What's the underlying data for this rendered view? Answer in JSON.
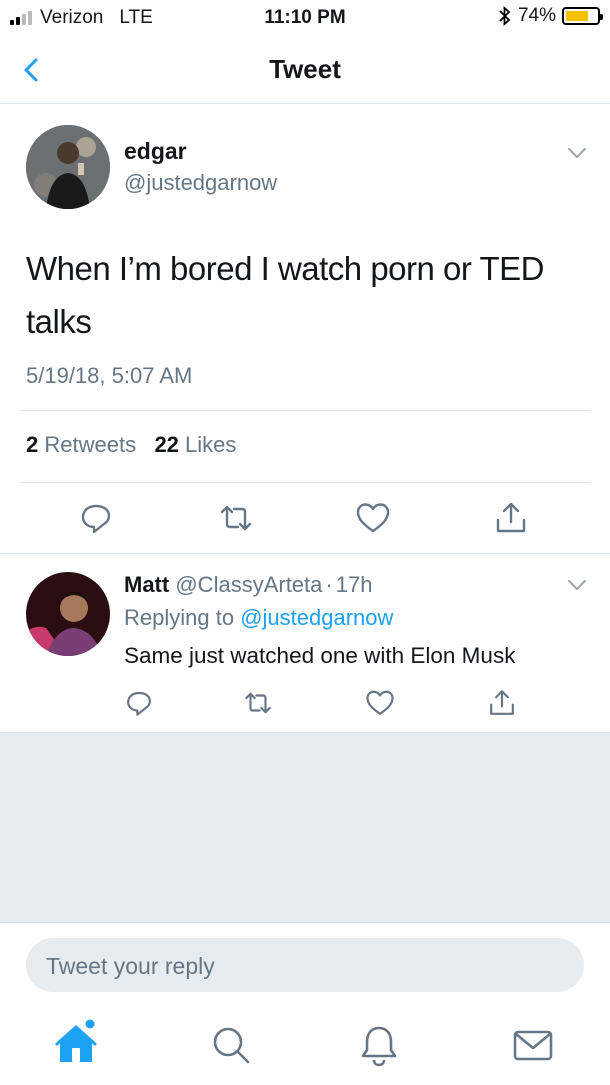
{
  "status_bar": {
    "carrier": "Verizon",
    "network": "LTE",
    "time": "11:10 PM",
    "battery_percent": "74%",
    "battery_level": 0.74
  },
  "nav": {
    "title": "Tweet"
  },
  "tweet": {
    "author_name": "edgar",
    "author_handle": "@justedgarnow",
    "text": "When I’m bored I watch porn or TED talks",
    "timestamp": "5/19/18, 5:07 AM",
    "retweets_count": "2",
    "retweets_label": "Retweets",
    "likes_count": "22",
    "likes_label": "Likes"
  },
  "reply": {
    "author_name": "Matt",
    "author_handle": "@ClassyArteta",
    "separator": "·",
    "age": "17h",
    "replying_prefix": "Replying to",
    "replying_handle": "@justedgarnow",
    "text": "Same just watched one with Elon Musk"
  },
  "composer": {
    "placeholder": "Tweet your reply"
  },
  "tab_bar": {
    "items": [
      "home-icon",
      "search-icon",
      "notifications-icon",
      "messages-icon"
    ]
  },
  "colors": {
    "accent": "#1da1f2",
    "secondary_text": "#657786",
    "divider": "#e1e8ed"
  }
}
